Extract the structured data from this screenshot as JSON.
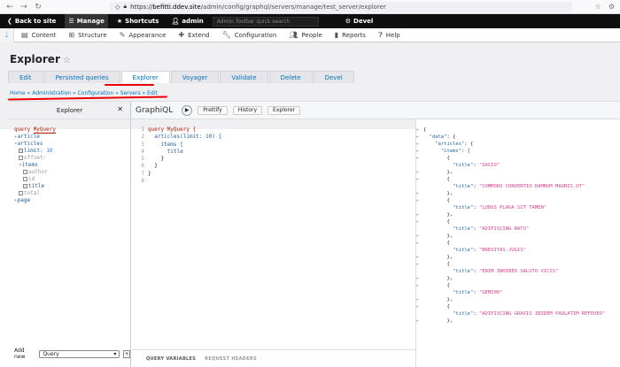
{
  "browser": {
    "url_prefix": "https://",
    "url_host": "befitti.ddev.site",
    "url_path": "/admin/config/graphql/servers/manage/test_server/explorer"
  },
  "toolbar": {
    "back": "Back to site",
    "manage": "Manage",
    "shortcuts": "Shortcuts",
    "user": "admin",
    "search_placeholder": "Admin Toolbar quick search",
    "devel": "Devel"
  },
  "admin_menu": [
    "Content",
    "Structure",
    "Appearance",
    "Extend",
    "Configuration",
    "People",
    "Reports",
    "Help"
  ],
  "page": {
    "title": "Explorer",
    "tabs": [
      "Edit",
      "Persisted queries",
      "Explorer",
      "Voyager",
      "Validate",
      "Delete",
      "Devel"
    ],
    "breadcrumb": "Home » Administration » Configuration » Servers » Edit"
  },
  "explorer": {
    "title": "Explorer",
    "close": "✕",
    "query_kw": "query",
    "query_name": "MyQuery",
    "tree": {
      "article": "article",
      "articles": "articles",
      "limit_label": "limit:",
      "limit_val": "10",
      "offset": "offset:",
      "items": "items",
      "author": "author",
      "id": "id",
      "title": "title",
      "total": "total",
      "page": "page"
    },
    "add_new": "Add new",
    "add_type": "Query"
  },
  "graphiql": {
    "title": "GraphiQL",
    "prettify": "Prettify",
    "history": "History",
    "explorer": "Explorer",
    "vars_tab": "QUERY VARIABLES",
    "headers_tab": "REQUEST HEADERS",
    "code": [
      {
        "n": "1",
        "t": "query MyQuery {"
      },
      {
        "n": "2",
        "t": "  articles(limit: 10) {"
      },
      {
        "n": "3",
        "t": "    items {"
      },
      {
        "n": "4",
        "t": "      title"
      },
      {
        "n": "5",
        "t": "    }"
      },
      {
        "n": "6",
        "t": "  }"
      },
      {
        "n": "7",
        "t": "}"
      },
      {
        "n": "8",
        "t": ""
      }
    ]
  },
  "result": {
    "titles": [
      "IACIO",
      "COMMODO CONVENTIO DAMNUM MAURIS UT",
      "LUDUS PLAGA SIT TAMEN",
      "ADIPISCING NATU",
      "BREVITAS JUGIS",
      "ENIM INHIBEO SALUTO VICIS",
      "GEMINO",
      "ADIPISCING GRAVIS IBIDEM PAULATIM REFOVEO"
    ]
  }
}
